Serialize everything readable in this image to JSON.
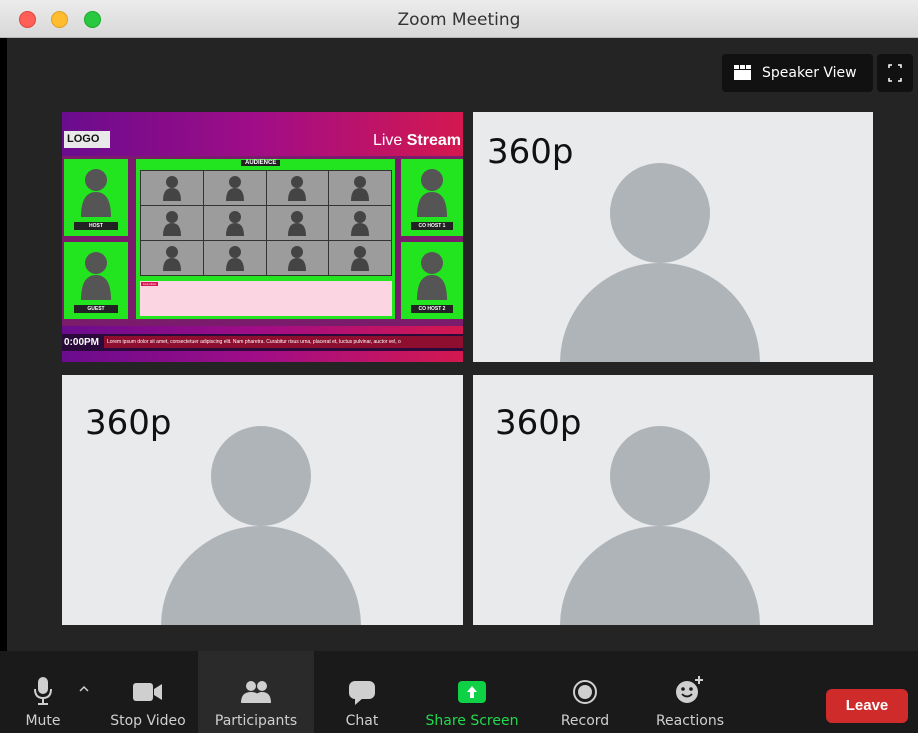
{
  "window": {
    "title": "Zoom Meeting"
  },
  "view_controls": {
    "speaker_view_label": "Speaker View"
  },
  "share_screen": {
    "logo_text": "LOGO",
    "live_text": "Live",
    "stream_text": "Stream",
    "audience_label": "AUDIENCE",
    "host_label": "HOST",
    "guest_label": "GUEST",
    "cohost1_label": "CO HOST 1",
    "cohost2_label": "CO HOST 2",
    "chat_tag": "Live Chat",
    "clock": "0:00PM",
    "ticker": "Lorem ipsum dolor sit amet, consectetuer adipiscing elit. Nam pharetra. Curabitur risus urna, placerat et, luctus pulvinar, auctor vel, o"
  },
  "participants": [
    {
      "resolution": "360p"
    },
    {
      "resolution": "360p"
    },
    {
      "resolution": "360p"
    }
  ],
  "toolbar": {
    "mute": "Mute",
    "stop_video": "Stop Video",
    "participants": "Participants",
    "chat": "Chat",
    "share_screen": "Share Screen",
    "record": "Record",
    "reactions": "Reactions",
    "leave": "Leave"
  },
  "colors": {
    "share_green": "#0ed145",
    "leave_red": "#cf2b2b",
    "chroma_green": "#22e51f"
  },
  "icons": [
    "microphone-icon",
    "chevron-up-icon",
    "video-camera-icon",
    "participants-icon",
    "chat-bubble-icon",
    "share-screen-icon",
    "record-icon",
    "reactions-icon",
    "speaker-view-icon",
    "fullscreen-icon"
  ]
}
